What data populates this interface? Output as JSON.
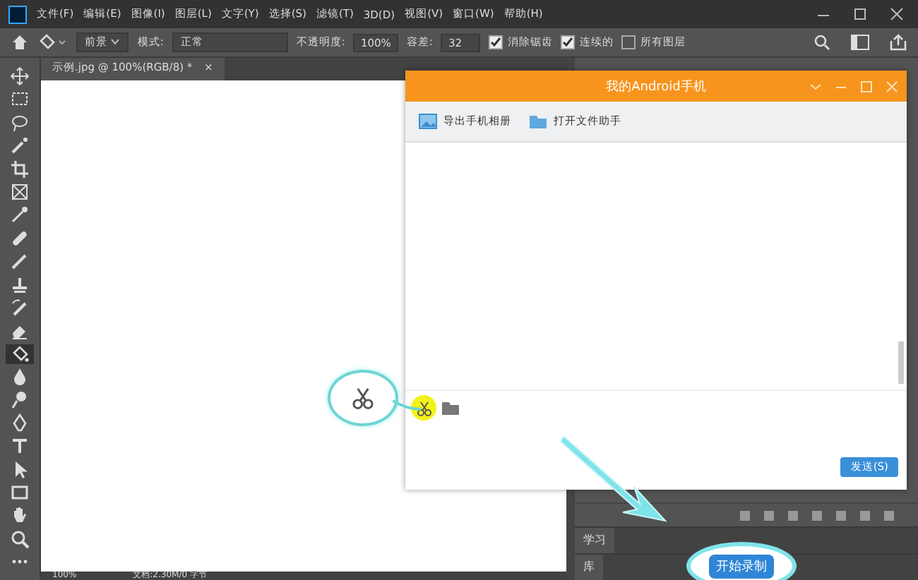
{
  "menu_bar": {
    "items": [
      "文件(F)",
      "编辑(E)",
      "图像(I)",
      "图层(L)",
      "文字(Y)",
      "选择(S)",
      "滤镜(T)",
      "3D(D)",
      "视图(V)",
      "窗口(W)",
      "帮助(H)"
    ]
  },
  "options_bar": {
    "fill_source": "前景",
    "mode_label": "模式:",
    "mode": "正常",
    "opacity_label": "不透明度:",
    "opacity": "100%",
    "tolerance_label": "容差:",
    "tolerance": "32",
    "checkboxes": [
      {
        "label": "消除锯齿",
        "checked": true
      },
      {
        "label": "连续的",
        "checked": true
      },
      {
        "label": "所有图层",
        "checked": false
      }
    ]
  },
  "document_tab": {
    "title": "示例.jpg @ 100%(RGB/8) *",
    "close": "×"
  },
  "tools": [
    {
      "selected": false
    },
    {
      "selected": false
    },
    {
      "selected": false
    },
    {
      "selected": false
    },
    {
      "selected": false
    },
    {
      "selected": false
    },
    {
      "selected": false
    },
    {
      "selected": false
    },
    {
      "selected": false
    },
    {
      "selected": false
    },
    {
      "selected": false
    },
    {
      "selected": false
    },
    {
      "selected": true
    },
    {
      "selected": false
    },
    {
      "selected": false
    },
    {
      "selected": false
    },
    {
      "selected": false
    },
    {
      "selected": false
    },
    {
      "selected": false
    },
    {
      "selected": false
    },
    {
      "selected": false
    },
    {
      "selected": false
    }
  ],
  "chat_window": {
    "title": "我的Android手机",
    "toolbar": [
      "导出手机相册",
      "打开文件助手"
    ],
    "send_button": "发送(S)"
  },
  "panels": {
    "tabs": [
      "学习",
      "库"
    ]
  },
  "status_bar": {
    "zoom": "100%",
    "document_info": "文档:2.30M/0 字节"
  },
  "annotation": {
    "record_button": "开始录制"
  }
}
